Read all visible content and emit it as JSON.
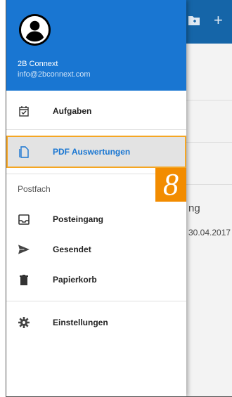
{
  "account": {
    "name": "2B Connext",
    "email": "info@2bconnext.com"
  },
  "menu": {
    "tasks": "Aufgaben",
    "pdf": "PDF Auswertungen",
    "mailbox_section": "Postfach",
    "inbox": "Posteingang",
    "sent": "Gesendet",
    "trash": "Papierkorb",
    "settings": "Einstellungen"
  },
  "callout": "8",
  "background": {
    "item_title_fragment": "ng",
    "item_date_fragment": "30.04.2017"
  },
  "colors": {
    "header": "#1976d2",
    "highlight": "#f5a623",
    "badge": "#f28c00"
  }
}
